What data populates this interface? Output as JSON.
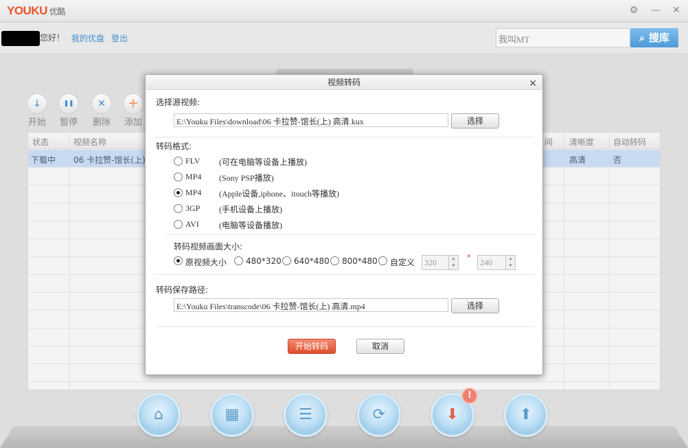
{
  "app": {
    "logo_brand": "YOUKU",
    "logo_cn": "优酷"
  },
  "window_controls": {
    "settings": "⚙",
    "minimize": "—",
    "close": "✕"
  },
  "userbar": {
    "greeting": "您好！",
    "my_youku": "我的优盘",
    "logout": "登出",
    "search_placeholder": "我叫MT",
    "search_button": "搜库"
  },
  "toolbar": [
    {
      "label": "开始",
      "icon": "download-arrow-icon",
      "glyph": "↓"
    },
    {
      "label": "暂停",
      "icon": "pause-icon",
      "glyph": "❚❚"
    },
    {
      "label": "删除",
      "icon": "delete-x-icon",
      "glyph": "✕"
    },
    {
      "label": "添加",
      "icon": "plus-icon",
      "glyph": "+"
    }
  ],
  "table": {
    "headers": [
      "状态",
      "视频名称",
      "间",
      "清晰度",
      "自动转码"
    ],
    "rows": [
      {
        "status": "下载中",
        "name": "06 卡拉赞-馆长(上)",
        "quality": "高清",
        "auto": "否"
      }
    ]
  },
  "dialog": {
    "title": "视频转码",
    "close": "✕",
    "source_label": "选择源视频:",
    "source_path": "E:\\Youku Files\\download\\06 卡拉赞-馆长(上) 高清.kux",
    "choose_button": "选择",
    "format_label": "转码格式:",
    "formats": [
      {
        "name": "FLV",
        "desc": "(可在电脑等设备上播放)",
        "selected": false
      },
      {
        "name": "MP4",
        "desc": "(Sony PSP播放)",
        "selected": false
      },
      {
        "name": "MP4",
        "desc": "(Apple设备,iphone、itouch等播放)",
        "selected": true
      },
      {
        "name": "3GP",
        "desc": "(手机设备上播放)",
        "selected": false
      },
      {
        "name": "AVI",
        "desc": "(电脑等设备播放)",
        "selected": false
      }
    ],
    "size_label": "转码视频画面大小:",
    "sizes": [
      {
        "label": "原视频大小",
        "selected": true
      },
      {
        "label": "480*320",
        "selected": false
      },
      {
        "label": "640*480",
        "selected": false
      },
      {
        "label": "800*480",
        "selected": false
      },
      {
        "label": "自定义",
        "selected": false
      }
    ],
    "custom_width": "320",
    "custom_height": "240",
    "star": "*",
    "save_label": "转码保存路径:",
    "save_path": "E:\\Youku Files\\transcode\\06 卡拉赞-馆长(上) 高清.mp4",
    "choose_button2": "选择",
    "start_button": "开始转码",
    "cancel_button": "取消"
  },
  "bottom_nav": [
    {
      "icon": "home-icon",
      "glyph": "⌂"
    },
    {
      "icon": "film-icon",
      "glyph": "▦"
    },
    {
      "icon": "list-icon",
      "glyph": "☰"
    },
    {
      "icon": "convert-icon",
      "glyph": "⟳"
    },
    {
      "icon": "download-icon",
      "glyph": "⬇"
    },
    {
      "icon": "upload-icon",
      "glyph": "⬆"
    }
  ],
  "download_badge": "!"
}
